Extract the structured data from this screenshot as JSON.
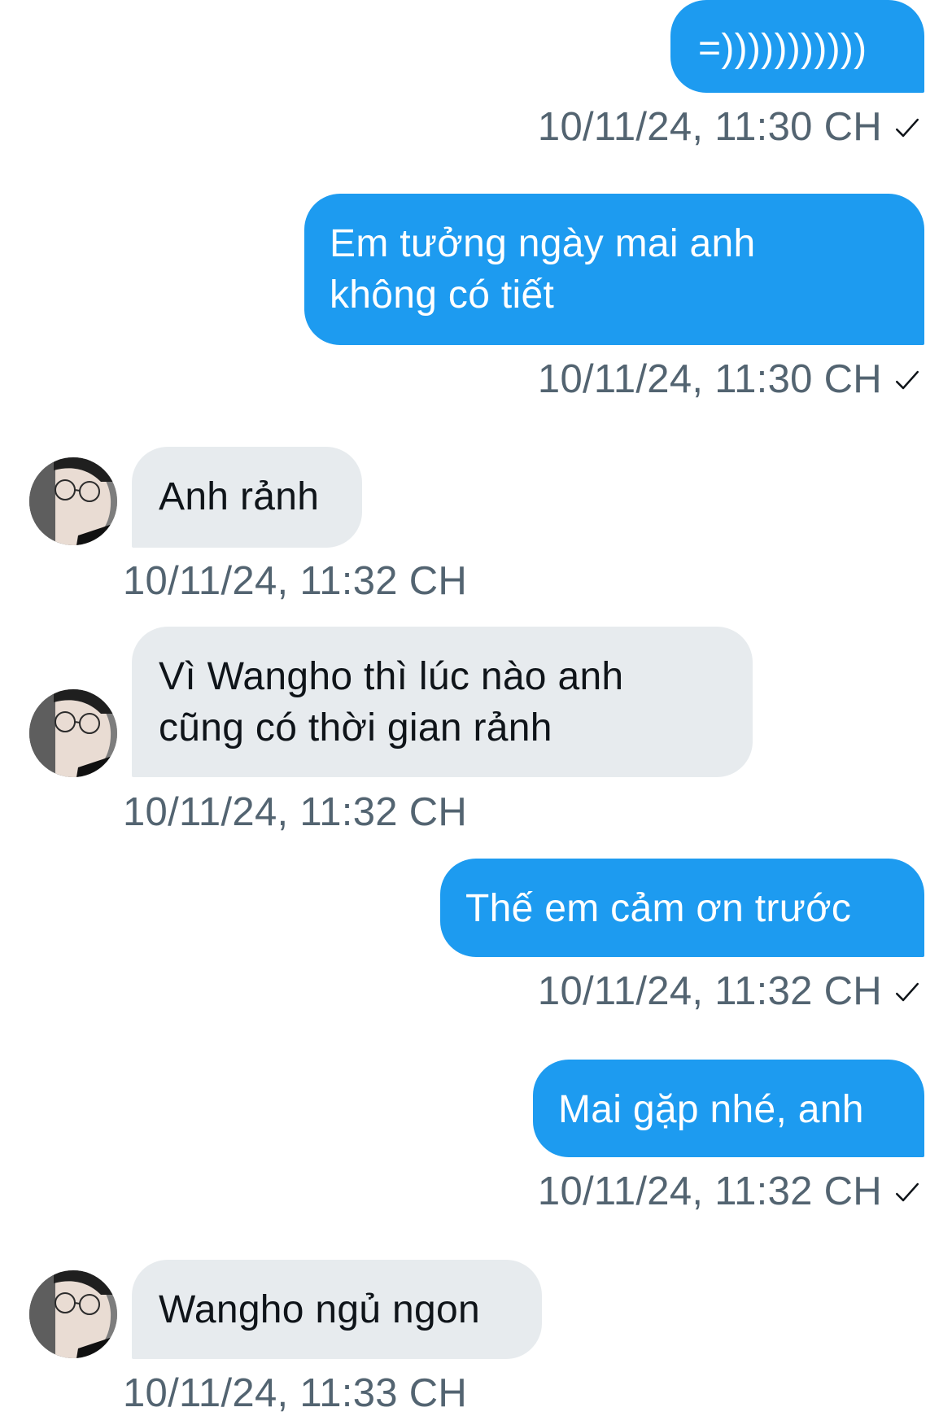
{
  "messages": [
    {
      "direction": "outgoing",
      "lines": [
        "=)))))))))))"
      ],
      "timestamp": "10/11/24, 11:30 CH",
      "read_icon": "check-icon"
    },
    {
      "direction": "outgoing",
      "lines": [
        "Em tưởng ngày mai anh",
        "không có tiết"
      ],
      "timestamp": "10/11/24, 11:30 CH",
      "read_icon": "check-icon"
    },
    {
      "direction": "incoming",
      "lines": [
        "Anh rảnh"
      ],
      "timestamp": "10/11/24, 11:32 CH",
      "avatar_icon": "avatar-photo"
    },
    {
      "direction": "incoming",
      "lines": [
        "Vì Wangho thì lúc nào anh",
        "cũng có thời gian rảnh"
      ],
      "timestamp": "10/11/24, 11:32 CH",
      "avatar_icon": "avatar-photo"
    },
    {
      "direction": "outgoing",
      "lines": [
        "Thế em cảm ơn trước"
      ],
      "timestamp": "10/11/24, 11:32 CH",
      "read_icon": "check-icon"
    },
    {
      "direction": "outgoing",
      "lines": [
        "Mai gặp nhé, anh"
      ],
      "timestamp": "10/11/24, 11:32 CH",
      "read_icon": "check-icon"
    },
    {
      "direction": "incoming",
      "lines": [
        "Wangho ngủ ngon"
      ],
      "timestamp": "10/11/24, 11:33 CH",
      "avatar_icon": "avatar-photo"
    }
  ],
  "colors": {
    "outgoing_bubble": "#1d9bf0",
    "incoming_bubble": "#e7ebee",
    "timestamp_text": "#536471",
    "incoming_text": "#0f1419"
  }
}
